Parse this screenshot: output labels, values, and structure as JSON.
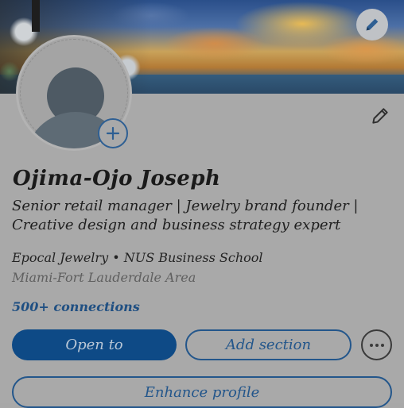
{
  "profile": {
    "name": "Ojima-Ojo Joseph",
    "headline": "Senior retail manager | Jewelry brand founder | Creative design and business strategy expert",
    "company_school": "Epocal Jewelry • NUS Business School",
    "location": "Miami-Fort Lauderdale Area",
    "connections": "500+ connections"
  },
  "actions": {
    "open_to": "Open to",
    "add_section": "Add section",
    "more": "•••",
    "enhance_profile": "Enhance profile"
  },
  "icons": {
    "cover_edit": "pencil-icon",
    "intro_edit": "pencil-icon",
    "avatar_add": "plus-icon",
    "more": "ellipsis-icon"
  },
  "colors": {
    "accent": "#0e4a86",
    "link": "#1f4f82"
  }
}
